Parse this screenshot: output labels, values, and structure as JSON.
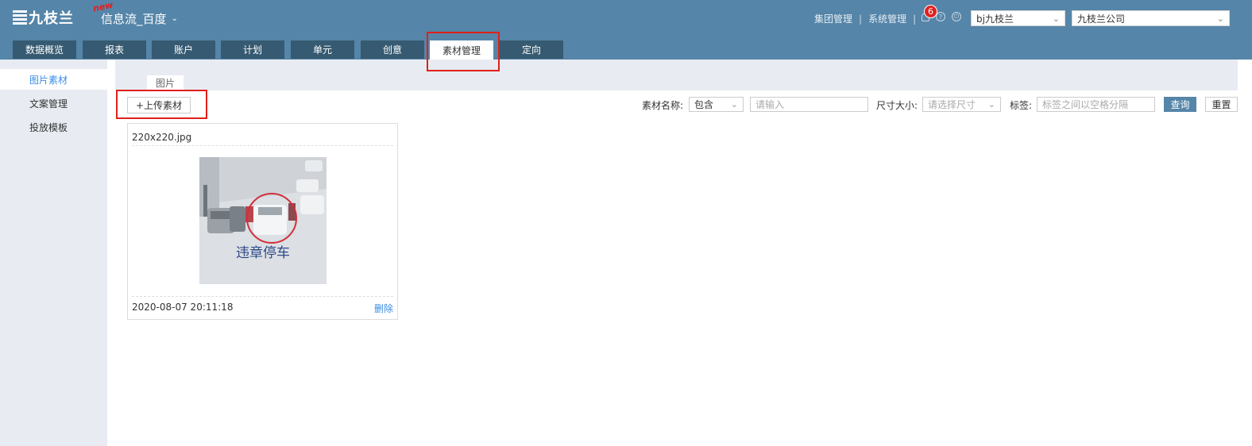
{
  "header": {
    "logo_text": "九枝兰",
    "new_badge": "new",
    "product_title": "信息流_百度",
    "links": [
      "集团管理",
      "系统管理"
    ],
    "notification_count": "6",
    "account_select": "bj九枝兰",
    "company_select": "九枝兰公司"
  },
  "tabs": [
    {
      "label": "数据概览"
    },
    {
      "label": "报表"
    },
    {
      "label": "账户"
    },
    {
      "label": "计划"
    },
    {
      "label": "单元"
    },
    {
      "label": "创意"
    },
    {
      "label": "素材管理",
      "active": true
    },
    {
      "label": "定向"
    }
  ],
  "sidebar": {
    "items": [
      {
        "label": "图片素材",
        "active": true
      },
      {
        "label": "文案管理"
      },
      {
        "label": "投放模板"
      }
    ]
  },
  "main": {
    "subtab": "图片",
    "upload_button": "+上传素材",
    "filters": {
      "name_label": "素材名称:",
      "name_match": "包含",
      "name_placeholder": "请输入",
      "size_label": "尺寸大小:",
      "size_placeholder": "请选择尺寸",
      "tag_label": "标签:",
      "tag_placeholder": "标签之间以空格分隔",
      "query_button": "查询",
      "reset_button": "重置"
    },
    "cards": [
      {
        "file_name": "220x220.jpg",
        "image_caption": "违章停车",
        "date": "2020-08-07 20:11:18",
        "delete_label": "删除"
      }
    ]
  },
  "colors": {
    "header_bg": "#5585a8",
    "tab_bg": "#365a71",
    "highlight_red": "#e0201a",
    "link_blue": "#3a8ee6"
  }
}
